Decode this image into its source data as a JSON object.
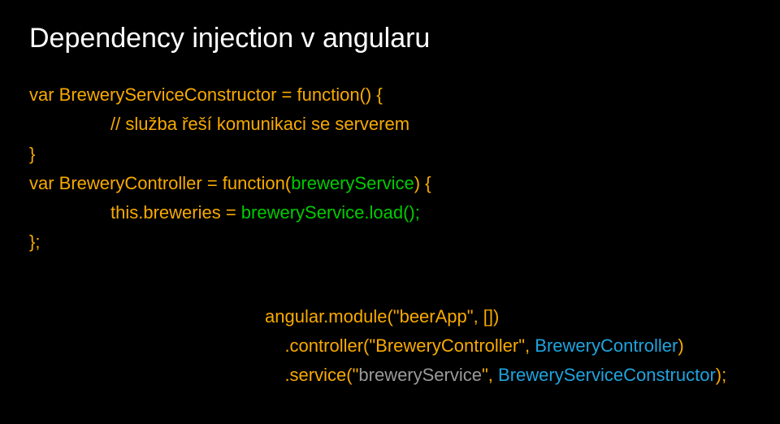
{
  "title": "Dependency injection v angularu",
  "code": {
    "line1": "var BreweryServiceConstructor = function() {",
    "line2": "// služba řeší komunikaci se serverem",
    "line3": "}",
    "line4_pre": "var BreweryController = function(",
    "line4_param": "breweryService",
    "line4_post": ") {",
    "line5_pre": "this.breweries = ",
    "line5_call": "breweryService.load();",
    "line6": "};"
  },
  "module": {
    "m1": "angular.module(\"beerApp\", [])",
    "m2_pre": "    .controller(\"BreweryController\", ",
    "m2_arg": "BreweryController",
    "m2_post": ")",
    "m3_pre": "    .service(\"",
    "m3_name": "breweryService",
    "m3_mid": "\", ",
    "m3_arg": "BreweryServiceConstructor",
    "m3_post": ");"
  }
}
